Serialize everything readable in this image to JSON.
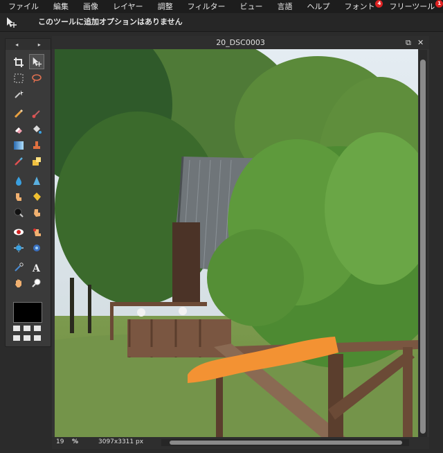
{
  "menu": {
    "items": [
      {
        "label": "ファイル"
      },
      {
        "label": "編集"
      },
      {
        "label": "画像"
      },
      {
        "label": "レイヤー"
      },
      {
        "label": "調整"
      },
      {
        "label": "フィルター"
      },
      {
        "label": "ビュー"
      },
      {
        "label": "言語"
      },
      {
        "label": "ヘルプ"
      },
      {
        "label": "フォント",
        "badge": "4"
      },
      {
        "label": "フリーツール",
        "badge": "1"
      }
    ]
  },
  "options_bar": {
    "message": "このツールに追加オプションはありません",
    "tool_icon": "move-tool-icon"
  },
  "tools_panel": {
    "nav_left": "◂",
    "nav_right": "▸",
    "foreground_color": "#000000"
  },
  "document": {
    "title": "20_DSC0003",
    "restore_glyph": "⧉",
    "close_glyph": "✕",
    "zoom_value": "19",
    "zoom_unit": "%",
    "dimensions": "3097x3311 px"
  },
  "colors": {
    "accent_brush": "#f39233",
    "badge": "#dd2222"
  }
}
